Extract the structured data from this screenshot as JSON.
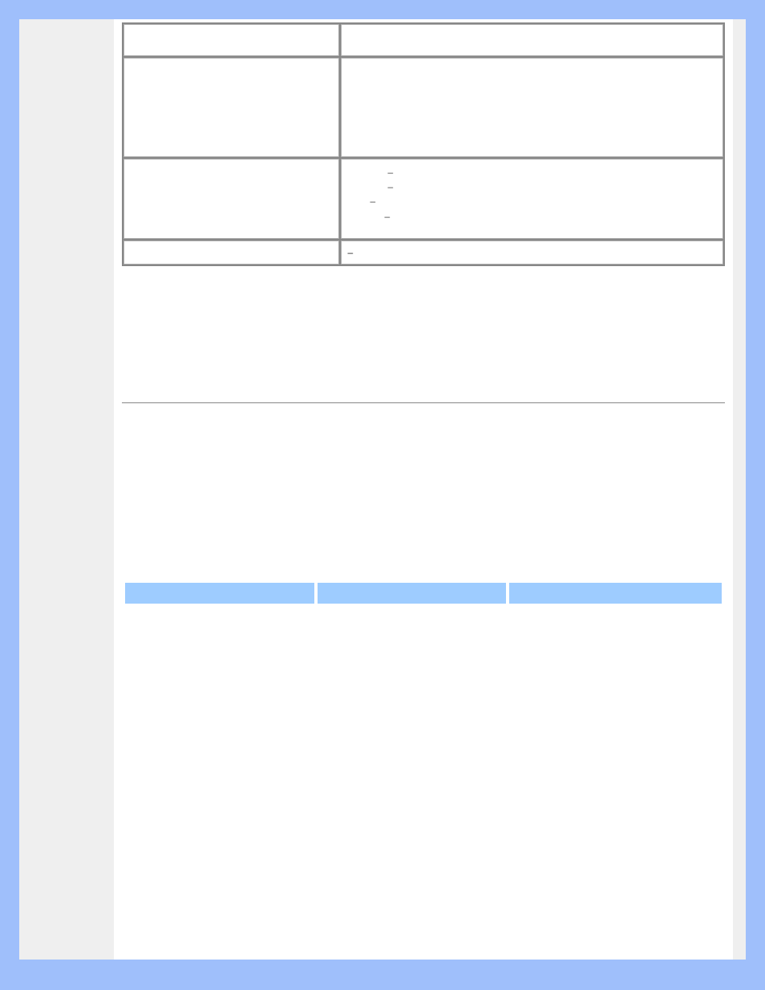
{
  "rows": [
    {
      "key": "",
      "value": ""
    },
    {
      "key": "",
      "value": ""
    },
    {
      "key": "",
      "dashes": [
        "–",
        "–",
        "–",
        "–"
      ],
      "dashIndents": [
        50,
        50,
        30,
        50
      ]
    },
    {
      "key": "",
      "valueDash": "–"
    }
  ],
  "headbar": {
    "cols": 3
  }
}
